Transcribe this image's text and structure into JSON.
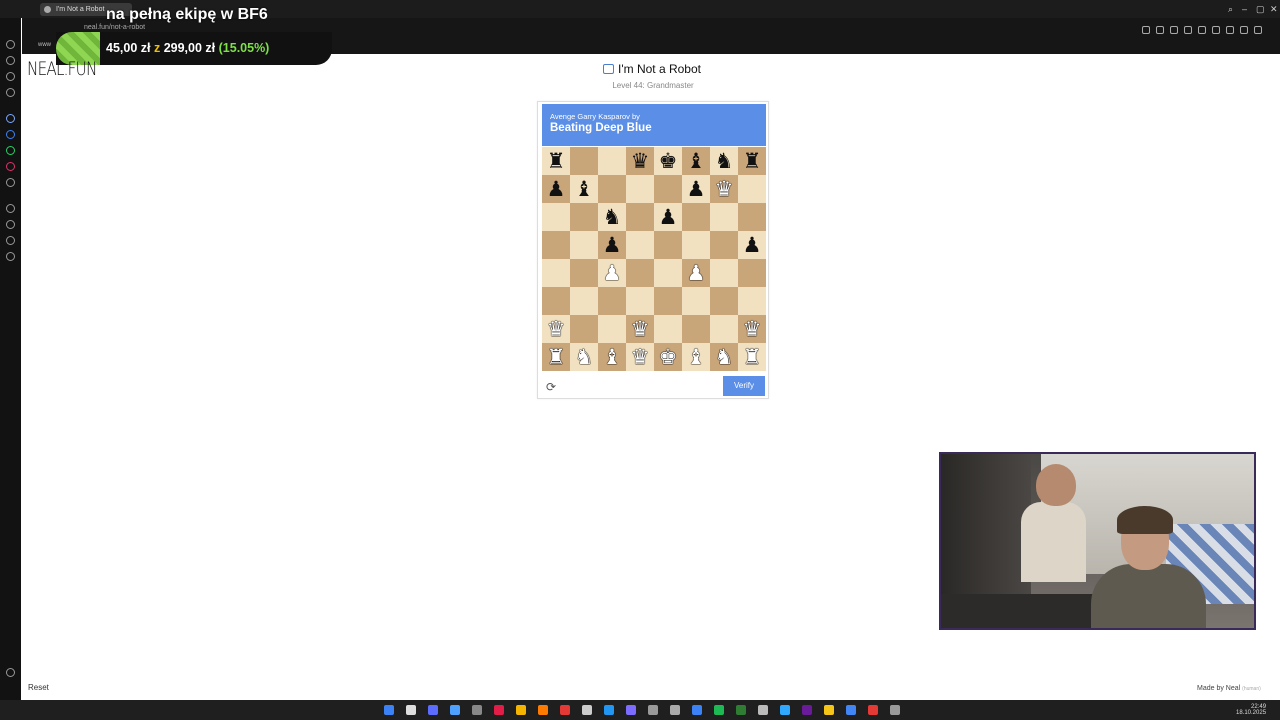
{
  "browser": {
    "tab_title": "I'm Not a Robot",
    "url": "neal.fun/not-a-robot",
    "bookmark": "www"
  },
  "overlay": {
    "headline": "na pełną ekipę w BF6",
    "amount": "45,00 zł",
    "of_word": "z",
    "goal": "299,00 zł",
    "percent": "(15.05%)"
  },
  "page": {
    "logo": "NEAL.FUN",
    "title": "I'm Not a Robot",
    "level": "Level 44: Grandmaster",
    "reset_label": "Reset",
    "made_by": "Made by Neal",
    "made_by_suffix": "(human)"
  },
  "captcha": {
    "subtitle": "Avenge Garry Kasparov by",
    "heading": "Beating Deep Blue",
    "verify_label": "Verify",
    "refresh_icon": "refresh-icon",
    "board": [
      [
        "br",
        "",
        "",
        "bq",
        "bk",
        "bb",
        "bn",
        "br"
      ],
      [
        "bp",
        "bb",
        "",
        "",
        "",
        "bp",
        "wq",
        ""
      ],
      [
        "",
        "",
        "bn",
        "",
        "bp",
        "",
        "",
        ""
      ],
      [
        "",
        "",
        "bp",
        "",
        "",
        "",
        "",
        "bp"
      ],
      [
        "",
        "",
        "wp",
        "",
        "",
        "wp",
        "",
        ""
      ],
      [
        "",
        "",
        "",
        "",
        "",
        "",
        "",
        ""
      ],
      [
        "wq",
        "",
        "",
        "wq",
        "",
        "",
        "",
        "wq"
      ],
      [
        "wr",
        "wn",
        "wb",
        "wq",
        "wk",
        "wb",
        "wn",
        "wr"
      ]
    ]
  },
  "taskbar": {
    "time": "22:49",
    "date": "18.10.2025"
  },
  "colors": {
    "captcha_blue": "#5b8ee6",
    "board_light": "#f2e1c0",
    "board_dark": "#c9a57a"
  }
}
